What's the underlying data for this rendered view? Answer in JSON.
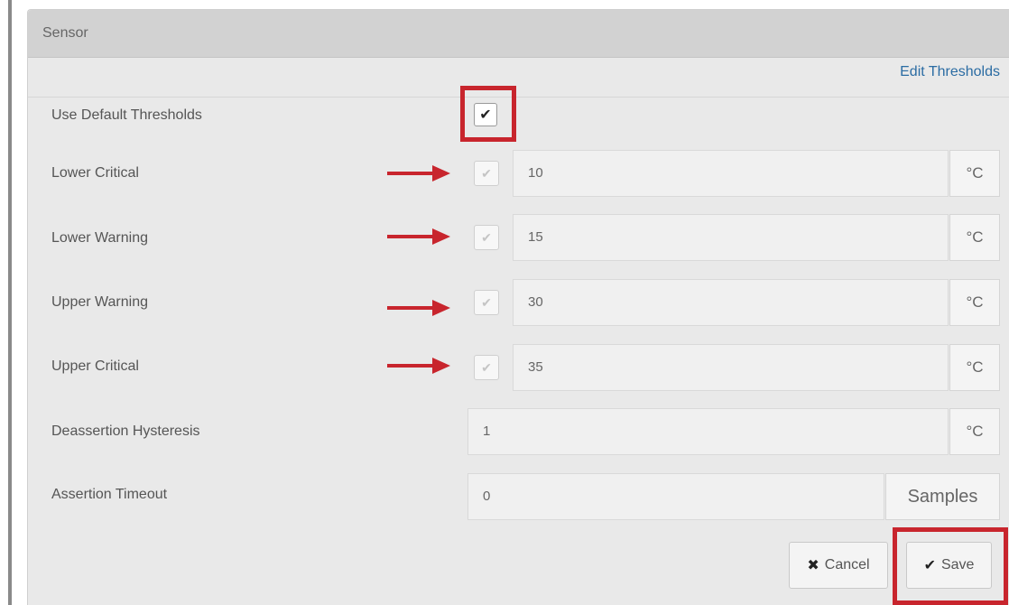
{
  "panel": {
    "title": "Sensor",
    "edit_link": "Edit Thresholds"
  },
  "use_default": {
    "label": "Use Default Thresholds",
    "checked": true
  },
  "thresholds": [
    {
      "label": "Lower Critical",
      "value": "10",
      "unit": "°C",
      "enabled": true
    },
    {
      "label": "Lower Warning",
      "value": "15",
      "unit": "°C",
      "enabled": true
    },
    {
      "label": "Upper Warning",
      "value": "30",
      "unit": "°C",
      "enabled": true
    },
    {
      "label": "Upper Critical",
      "value": "35",
      "unit": "°C",
      "enabled": true
    }
  ],
  "hysteresis": {
    "label": "Deassertion Hysteresis",
    "value": "1",
    "unit": "°C"
  },
  "timeout": {
    "label": "Assertion Timeout",
    "value": "0",
    "unit": "Samples"
  },
  "actions": {
    "cancel_label": "Cancel",
    "save_label": "Save"
  },
  "colors": {
    "annotation_red": "#c8252d",
    "link_blue": "#2b6ca3"
  },
  "icons": {
    "cancel": "x-icon",
    "save": "checkmark-icon",
    "arrow": "arrow-right-icon"
  }
}
